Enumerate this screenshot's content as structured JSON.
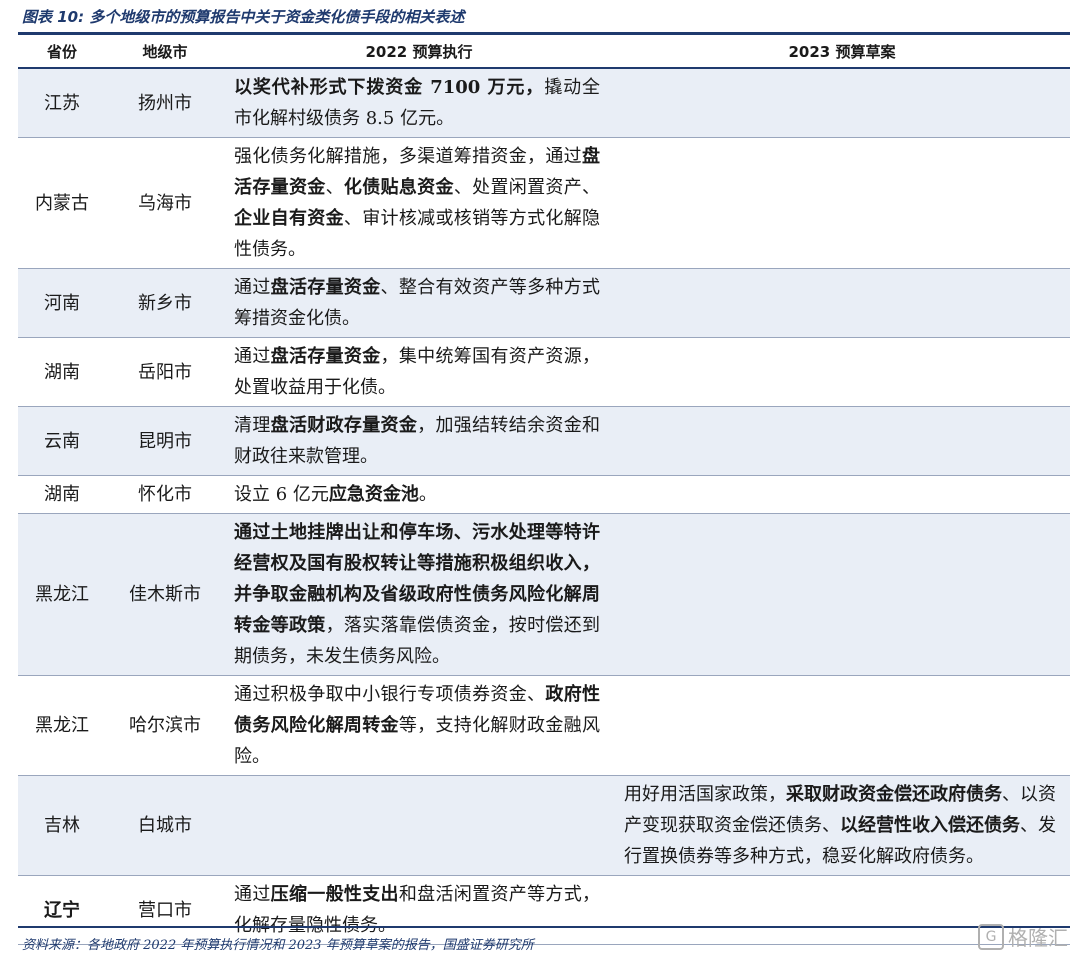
{
  "title": "图表 10:  多个地级市的预算报告中关于资金类化债手段的相关表述",
  "headers": [
    "省份",
    "地级市",
    "2022 预算执行",
    "2023 预算草案"
  ],
  "rows": [
    {
      "province": "江苏",
      "city": "扬州市",
      "y2022": [
        {
          "t": "以奖代补形式下拨资金 7100 万元，",
          "b": true
        },
        {
          "t": "撬动全市化解村级债务 8.5 亿元。",
          "b": false
        }
      ],
      "y2023": []
    },
    {
      "province": "内蒙古",
      "city": "乌海市",
      "y2022": [
        {
          "t": "强化债务化解措施，多渠道筹措资金，通过",
          "b": false
        },
        {
          "t": "盘活存量资金",
          "b": true
        },
        {
          "t": "、",
          "b": false
        },
        {
          "t": "化债贴息资金",
          "b": true
        },
        {
          "t": "、处置闲置资产、",
          "b": false
        },
        {
          "t": "企业自有资金",
          "b": true
        },
        {
          "t": "、审计核减或核销等方式化解隐性债务。",
          "b": false
        }
      ],
      "y2023": []
    },
    {
      "province": "河南",
      "city": "新乡市",
      "y2022": [
        {
          "t": "通过",
          "b": false
        },
        {
          "t": "盘活存量资金",
          "b": true
        },
        {
          "t": "、整合有效资产等多种方式筹措资金化债。",
          "b": false
        }
      ],
      "y2023": []
    },
    {
      "province": "湖南",
      "city": "岳阳市",
      "y2022": [
        {
          "t": "通过",
          "b": false
        },
        {
          "t": "盘活存量资金",
          "b": true
        },
        {
          "t": "，集中统筹国有资产资源，处置收益用于化债。",
          "b": false
        }
      ],
      "y2023": []
    },
    {
      "province": "云南",
      "city": "昆明市",
      "y2022": [
        {
          "t": "清理",
          "b": false
        },
        {
          "t": "盘活财政存量资金",
          "b": true
        },
        {
          "t": "，加强结转结余资金和财政往来款管理。",
          "b": false
        }
      ],
      "y2023": []
    },
    {
      "province": "湖南",
      "city": "怀化市",
      "y2022": [
        {
          "t": "设立 6 亿元",
          "b": false
        },
        {
          "t": "应急资金池",
          "b": true
        },
        {
          "t": "。",
          "b": false
        }
      ],
      "y2023": []
    },
    {
      "province": "黑龙江",
      "city": "佳木斯市",
      "y2022": [
        {
          "t": "通过土地挂牌出让和停车场、污水处理等特许经营权及国有股权转让等措施积极组织收入，并争取金融机构及省级政府性债务风险化解周转金等政策",
          "b": true
        },
        {
          "t": "，落实落靠偿债资金，按时偿还到期债务，未发生债务风险。",
          "b": false
        }
      ],
      "y2023": []
    },
    {
      "province": "黑龙江",
      "city": "哈尔滨市",
      "y2022": [
        {
          "t": "通过积极争取中小银行专项债券资金、",
          "b": false
        },
        {
          "t": "政府性债务风险化解周转金",
          "b": true
        },
        {
          "t": "等，支持化解财政金融风险。",
          "b": false
        }
      ],
      "y2023": []
    },
    {
      "province": "吉林",
      "city": "白城市",
      "y2022": [],
      "y2023": [
        {
          "t": "用好用活国家政策，",
          "b": false
        },
        {
          "t": "采取财政资金偿还政府债务",
          "b": true
        },
        {
          "t": "、以资产变现获取资金偿还债务、",
          "b": false
        },
        {
          "t": "以经营性收入偿还债务",
          "b": true
        },
        {
          "t": "、发行置换债券等多种方式，稳妥化解政府债务。",
          "b": false
        }
      ]
    },
    {
      "province": "辽宁",
      "city": "营口市",
      "y2022": [
        {
          "t": "通过",
          "b": false
        },
        {
          "t": "压缩一般性支出",
          "b": true
        },
        {
          "t": "和盘活闲置资产等方式，化解存量隐性债务。",
          "b": false
        }
      ],
      "y2023": []
    }
  ],
  "source": "资料来源：各地政府 2022 年预算执行情况和 2023 年预算草案的报告，国盛证券研究所",
  "watermark": "格隆汇"
}
